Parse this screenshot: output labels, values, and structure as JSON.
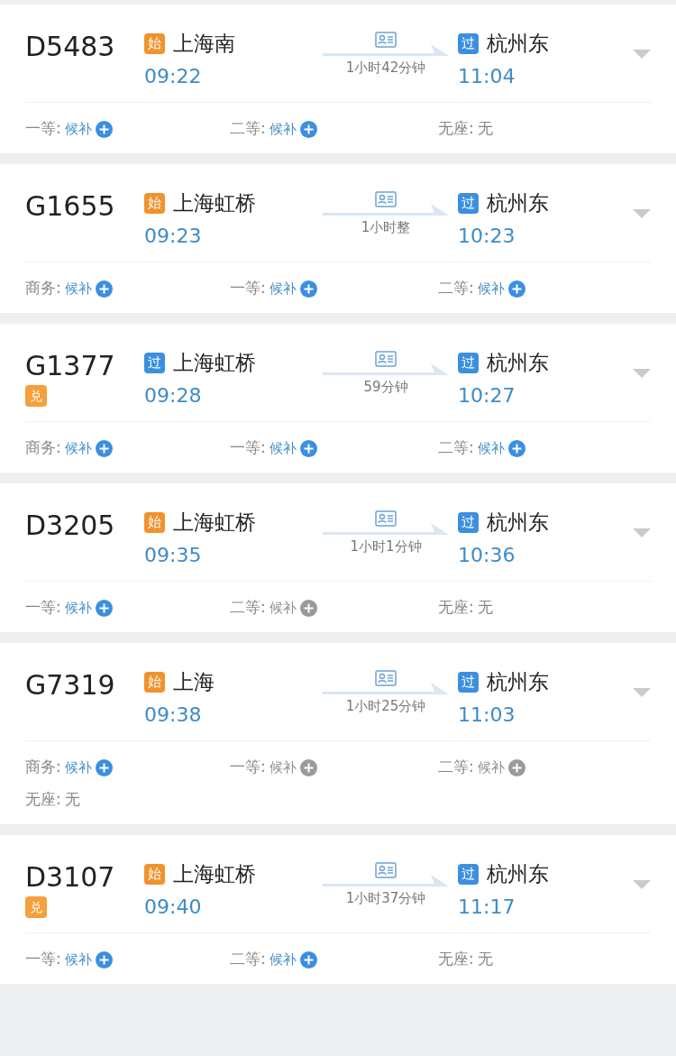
{
  "trains": [
    {
      "number": "D5483",
      "from": {
        "tag": "始",
        "kind": "start",
        "station": "上海南",
        "time": "09:22"
      },
      "duration": "1小时42分钟",
      "to": {
        "tag": "过",
        "kind": "pass",
        "station": "杭州东",
        "time": "11:04"
      },
      "seats": [
        {
          "label": "一等:",
          "kind": "waitlist",
          "value": "候补",
          "disabled": false
        },
        {
          "label": "二等:",
          "kind": "waitlist",
          "value": "候补",
          "disabled": false
        },
        {
          "label": "无座:",
          "kind": "none",
          "value": "无"
        }
      ]
    },
    {
      "number": "G1655",
      "from": {
        "tag": "始",
        "kind": "start",
        "station": "上海虹桥",
        "time": "09:23"
      },
      "duration": "1小时整",
      "to": {
        "tag": "过",
        "kind": "pass",
        "station": "杭州东",
        "time": "10:23"
      },
      "seats": [
        {
          "label": "商务:",
          "kind": "waitlist",
          "value": "候补",
          "disabled": false
        },
        {
          "label": "一等:",
          "kind": "waitlist",
          "value": "候补",
          "disabled": false
        },
        {
          "label": "二等:",
          "kind": "waitlist",
          "value": "候补",
          "disabled": false
        }
      ]
    },
    {
      "number": "G1377",
      "badge": "兑",
      "from": {
        "tag": "过",
        "kind": "pass",
        "station": "上海虹桥",
        "time": "09:28"
      },
      "duration": "59分钟",
      "to": {
        "tag": "过",
        "kind": "pass",
        "station": "杭州东",
        "time": "10:27"
      },
      "seats": [
        {
          "label": "商务:",
          "kind": "waitlist",
          "value": "候补",
          "disabled": false
        },
        {
          "label": "一等:",
          "kind": "waitlist",
          "value": "候补",
          "disabled": false
        },
        {
          "label": "二等:",
          "kind": "waitlist",
          "value": "候补",
          "disabled": false
        }
      ]
    },
    {
      "number": "D3205",
      "from": {
        "tag": "始",
        "kind": "start",
        "station": "上海虹桥",
        "time": "09:35"
      },
      "duration": "1小时1分钟",
      "to": {
        "tag": "过",
        "kind": "pass",
        "station": "杭州东",
        "time": "10:36"
      },
      "seats": [
        {
          "label": "一等:",
          "kind": "waitlist",
          "value": "候补",
          "disabled": false
        },
        {
          "label": "二等:",
          "kind": "waitlist",
          "value": "候补",
          "disabled": true
        },
        {
          "label": "无座:",
          "kind": "none",
          "value": "无"
        }
      ]
    },
    {
      "number": "G7319",
      "from": {
        "tag": "始",
        "kind": "start",
        "station": "上海",
        "time": "09:38"
      },
      "duration": "1小时25分钟",
      "to": {
        "tag": "过",
        "kind": "pass",
        "station": "杭州东",
        "time": "11:03"
      },
      "seats": [
        {
          "label": "商务:",
          "kind": "waitlist",
          "value": "候补",
          "disabled": false
        },
        {
          "label": "一等:",
          "kind": "waitlist",
          "value": "候补",
          "disabled": true
        },
        {
          "label": "二等:",
          "kind": "waitlist",
          "value": "候补",
          "disabled": true
        },
        {
          "label": "无座:",
          "kind": "none",
          "value": "无"
        }
      ]
    },
    {
      "number": "D3107",
      "badge": "兑",
      "from": {
        "tag": "始",
        "kind": "start",
        "station": "上海虹桥",
        "time": "09:40"
      },
      "duration": "1小时37分钟",
      "to": {
        "tag": "过",
        "kind": "pass",
        "station": "杭州东",
        "time": "11:17"
      },
      "seats": [
        {
          "label": "一等:",
          "kind": "waitlist",
          "value": "候补",
          "disabled": false
        },
        {
          "label": "二等:",
          "kind": "waitlist",
          "value": "候补",
          "disabled": false
        },
        {
          "label": "无座:",
          "kind": "none",
          "value": "无"
        }
      ]
    }
  ]
}
